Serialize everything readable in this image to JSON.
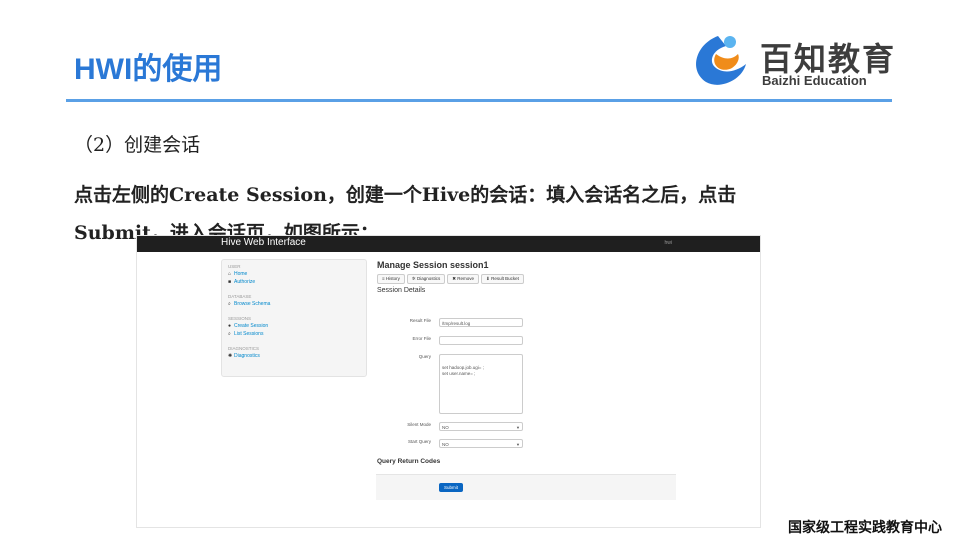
{
  "slide": {
    "title": "HWI的使用",
    "subtitle": "（2）创建会话",
    "body_line1": "点击左侧的Create Session，创建一个Hive的会话：填入会话名之后，点击",
    "body_line2": "Submit，进入会话页，如图所示：",
    "footer": "国家级工程实践教育中心"
  },
  "logo": {
    "cn": "百知教育",
    "en": "Baizhi Education"
  },
  "colors": {
    "title": "#2a78d6",
    "rule": "#5aa0e6",
    "navbar": "#1f1f1f",
    "link": "#0088cc",
    "submit": "#0a66c2"
  },
  "hwi": {
    "brand": "Hive Web Interface",
    "nav_right": "hwi",
    "sidebar": {
      "groups": [
        {
          "heading": "USER",
          "items": [
            {
              "icon": "home-icon",
              "glyph": "⌂",
              "label": "Home"
            },
            {
              "icon": "lock-icon",
              "glyph": "■",
              "label": "Authorize"
            }
          ]
        },
        {
          "heading": "DATABASE",
          "items": [
            {
              "icon": "search-icon",
              "glyph": "⌕",
              "label": "Browse Schema"
            }
          ]
        },
        {
          "heading": "SESSIONS",
          "items": [
            {
              "icon": "user-icon",
              "glyph": "●",
              "label": "Create Session"
            },
            {
              "icon": "search-icon",
              "glyph": "⌕",
              "label": "List Sessions"
            }
          ]
        },
        {
          "heading": "DIAGNOSTICS",
          "items": [
            {
              "icon": "gear-icon",
              "glyph": "✺",
              "label": "Diagnostics"
            }
          ]
        }
      ]
    },
    "page_title": "Manage Session session1",
    "toolbar": [
      {
        "glyph": "≡",
        "label": "History"
      },
      {
        "glyph": "✲",
        "label": "Diagnostics"
      },
      {
        "glyph": "✖",
        "label": "Remove"
      },
      {
        "glyph": "⬇",
        "label": "Result Bucket"
      }
    ],
    "section_title": "Session Details",
    "form": {
      "result_file_label": "Result File",
      "result_file_value": "/tmp/result.log",
      "error_file_label": "Error File",
      "error_file_value": "",
      "query_label": "Query",
      "query_line1": "set hadoop.job.ugi= ;",
      "query_line2": "set user.name= ;",
      "silent_mode_label": "Silent Mode",
      "silent_mode_value": "NO",
      "start_query_label": "Start Query",
      "start_query_value": "NO"
    },
    "query_return_codes": "Query Return Codes",
    "submit_label": "Submit"
  }
}
